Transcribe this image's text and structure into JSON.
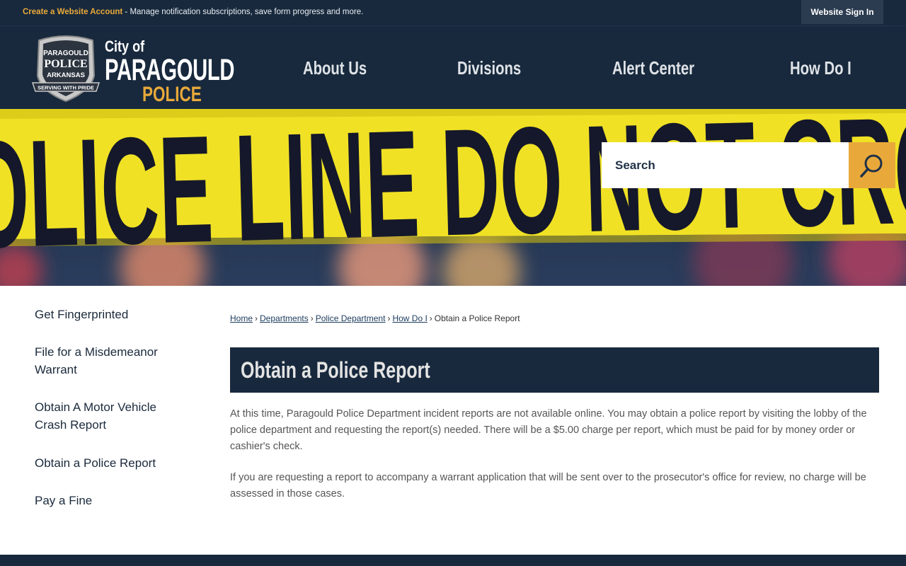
{
  "topbar": {
    "promo_link": "Create a Website Account",
    "promo_text": " - Manage notification subscriptions, save form progress and more.",
    "signin_label": "Website Sign In"
  },
  "badge": {
    "line1": "PARAGOULD",
    "line2": "POLICE",
    "line3": "ARKANSAS",
    "motto": "SERVING WITH PRIDE"
  },
  "brand": {
    "city_of": "City of",
    "name": "PARAGOULD",
    "sub": "POLICE"
  },
  "nav": {
    "items": [
      {
        "label": "About Us"
      },
      {
        "label": "Divisions"
      },
      {
        "label": "Alert Center"
      },
      {
        "label": "How Do I"
      }
    ]
  },
  "hero": {
    "tape_text": "OLICE LINE DO NOT CRO"
  },
  "search": {
    "placeholder": "Search"
  },
  "sidebar": {
    "items": [
      {
        "label": "Get Fingerprinted"
      },
      {
        "label": "File for a Misdemeanor Warrant"
      },
      {
        "label": "Obtain A Motor Vehicle Crash Report"
      },
      {
        "label": "Obtain a Police Report"
      },
      {
        "label": "Pay a Fine"
      }
    ]
  },
  "breadcrumb": {
    "items": [
      "Home",
      "Departments",
      "Police Department",
      "How Do I"
    ],
    "current": "Obtain a Police Report"
  },
  "page": {
    "title": "Obtain a Police Report",
    "paragraphs": [
      "At this time, Paragould Police Department incident reports are not available online.  You may obtain a police report by visiting the lobby of the police department and requesting the report(s) needed.  There will be a $5.00 charge per report, which must be paid for by money order or cashier's check.",
      "If you are requesting a report to accompany a warrant application that will be sent over to the prosecutor's office for review, no charge will be assessed in those cases."
    ]
  },
  "colors": {
    "navy": "#18293d",
    "accent": "#e9a93a",
    "tape": "#f0e125"
  }
}
